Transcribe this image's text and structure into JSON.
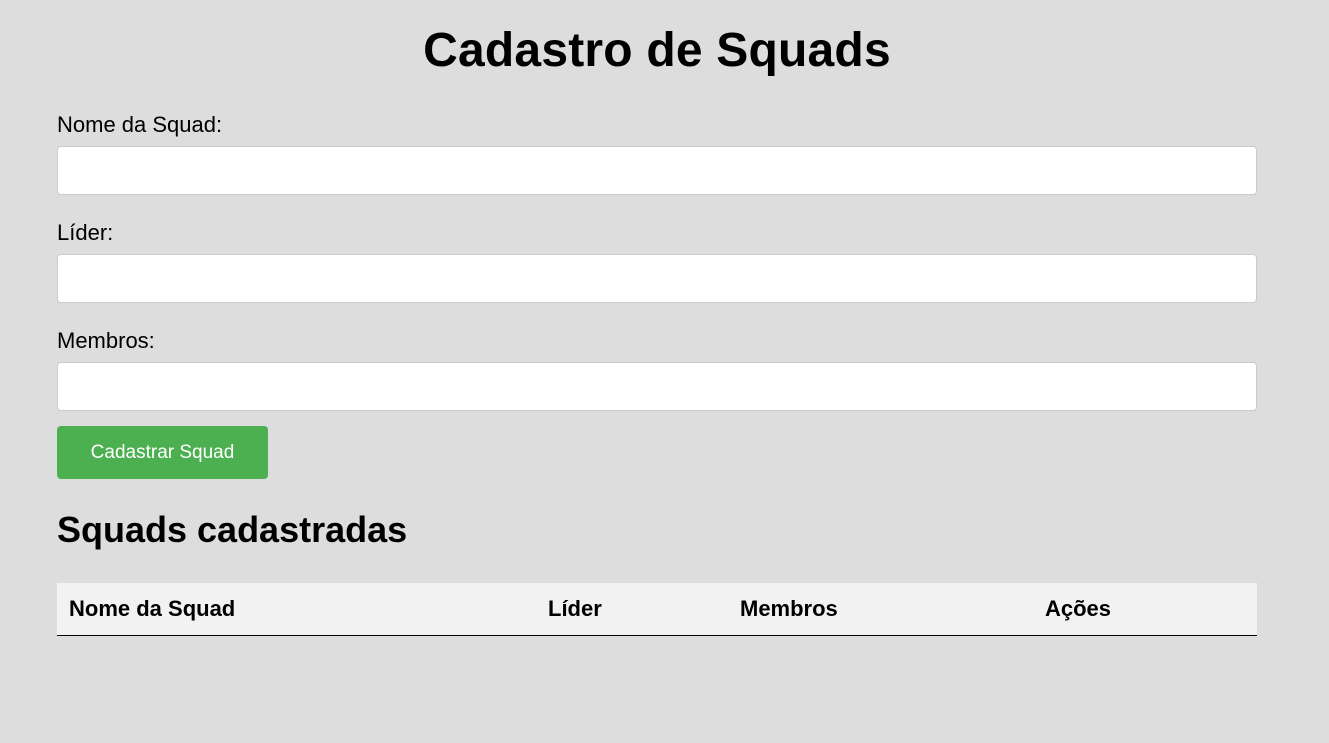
{
  "page": {
    "title": "Cadastro de Squads"
  },
  "form": {
    "squad_name_label": "Nome da Squad:",
    "squad_name_value": "",
    "leader_label": "Líder:",
    "leader_value": "",
    "members_label": "Membros:",
    "members_value": "",
    "submit_label": "Cadastrar Squad"
  },
  "list": {
    "heading": "Squads cadastradas",
    "columns": [
      "Nome da Squad",
      "Líder",
      "Membros",
      "Ações"
    ],
    "rows": []
  },
  "colors": {
    "background": "#dddddd",
    "submit_button": "#4caf50",
    "table_header": "#f2f2f2"
  }
}
